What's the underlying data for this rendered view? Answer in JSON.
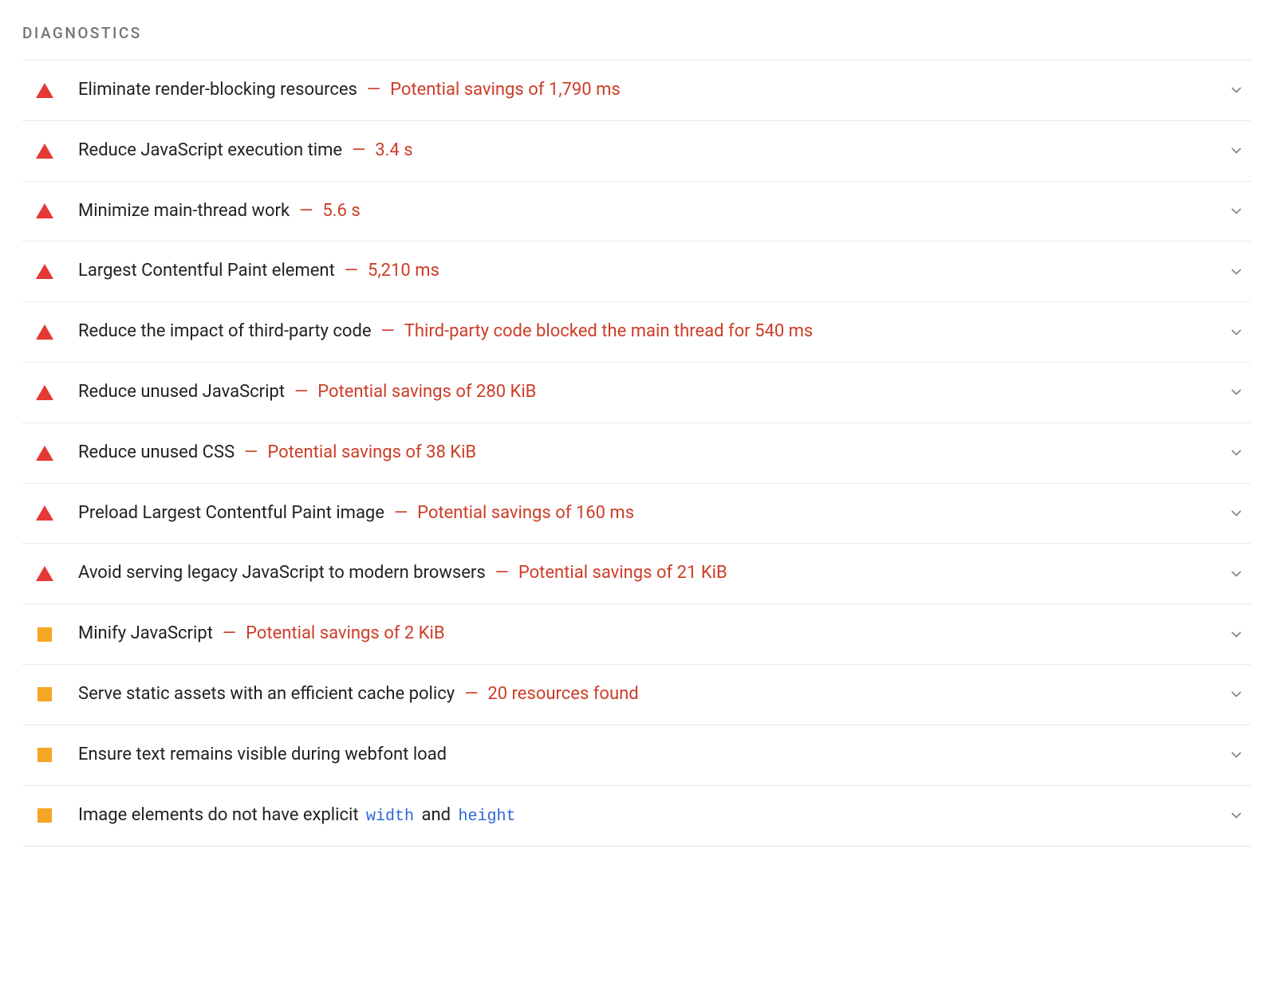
{
  "section": {
    "title": "DIAGNOSTICS"
  },
  "audits": [
    {
      "severity": "fail",
      "title": "Eliminate render-blocking resources",
      "value": "Potential savings of 1,790 ms"
    },
    {
      "severity": "fail",
      "title": "Reduce JavaScript execution time",
      "value": "3.4 s"
    },
    {
      "severity": "fail",
      "title": "Minimize main-thread work",
      "value": "5.6 s"
    },
    {
      "severity": "fail",
      "title": "Largest Contentful Paint element",
      "value": "5,210 ms"
    },
    {
      "severity": "fail",
      "title": "Reduce the impact of third-party code",
      "value": "Third-party code blocked the main thread for 540 ms"
    },
    {
      "severity": "fail",
      "title": "Reduce unused JavaScript",
      "value": "Potential savings of 280 KiB"
    },
    {
      "severity": "fail",
      "title": "Reduce unused CSS",
      "value": "Potential savings of 38 KiB"
    },
    {
      "severity": "fail",
      "title": "Preload Largest Contentful Paint image",
      "value": "Potential savings of 160 ms"
    },
    {
      "severity": "fail",
      "title": "Avoid serving legacy JavaScript to modern browsers",
      "value": "Potential savings of 21 KiB"
    },
    {
      "severity": "warn",
      "title": "Minify JavaScript",
      "value": "Potential savings of 2 KiB"
    },
    {
      "severity": "warn",
      "title": "Serve static assets with an efficient cache policy",
      "value": "20 resources found"
    },
    {
      "severity": "warn",
      "title": "Ensure text remains visible during webfont load",
      "value": ""
    },
    {
      "severity": "warn",
      "title_parts": [
        {
          "text": "Image elements do not have explicit "
        },
        {
          "code": "width"
        },
        {
          "text": " and "
        },
        {
          "code": "height"
        }
      ],
      "value": ""
    }
  ],
  "colors": {
    "fail": "#E53935",
    "warn": "#F5A623",
    "value_text": "#CC3D27",
    "code_text": "#2B66D9"
  }
}
